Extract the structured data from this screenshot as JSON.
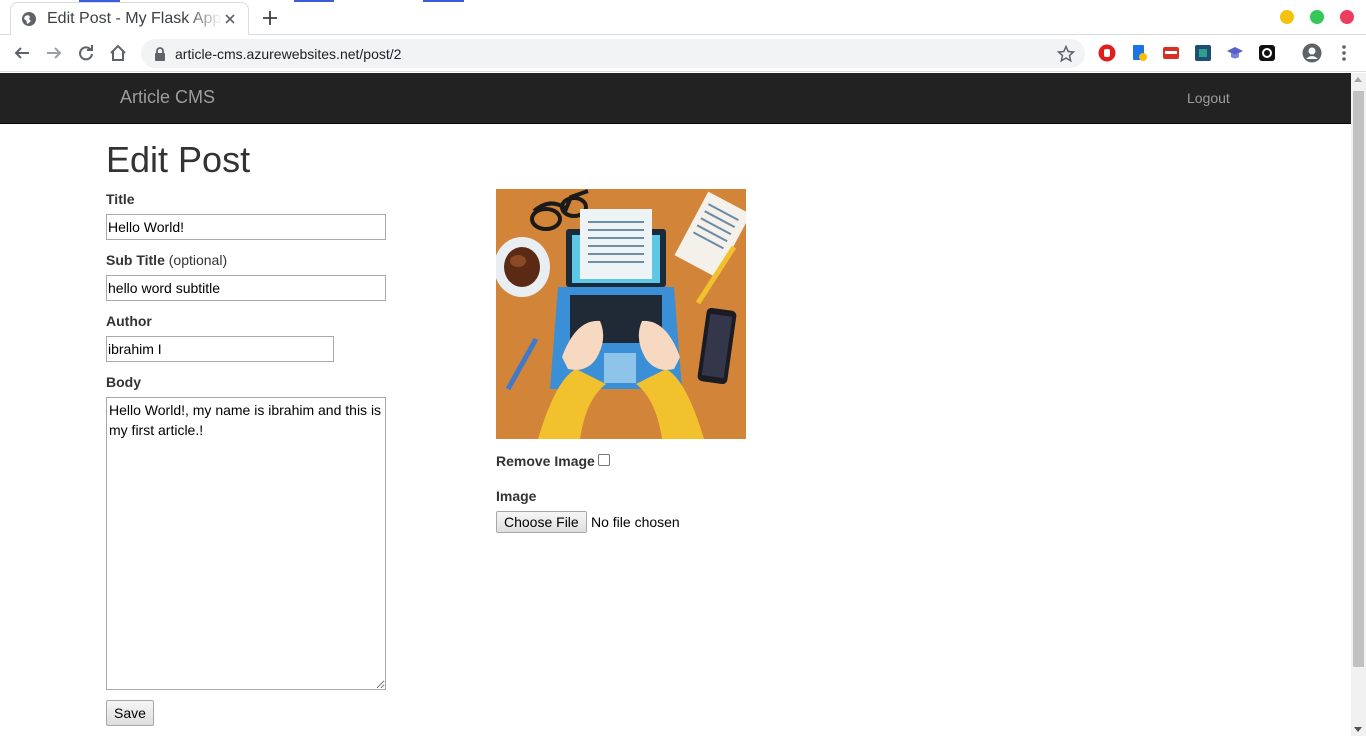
{
  "browser": {
    "tab_title": "Edit Post - My Flask App",
    "url": "article-cms.azurewebsites.net/post/2"
  },
  "nav": {
    "brand": "Article CMS",
    "logout": "Logout"
  },
  "form": {
    "heading": "Edit Post",
    "title_label": "Title",
    "title_value": "Hello World!",
    "subtitle_label": "Sub Title",
    "subtitle_optional": "(optional)",
    "subtitle_value": "hello word subtitle",
    "author_label": "Author",
    "author_value": "ibrahim I",
    "body_label": "Body",
    "body_value": "Hello World!, my name is ibrahim and this is my first article.!",
    "remove_image_label": "Remove Image",
    "image_label": "Image",
    "choose_file": "Choose File",
    "no_file": "No file chosen",
    "save": "Save"
  },
  "icons": {
    "extensions": [
      "red-shield-icon",
      "blue-doc-icon",
      "red-badge-icon",
      "teal-square-icon",
      "purple-cap-icon",
      "black-square-icon"
    ]
  }
}
